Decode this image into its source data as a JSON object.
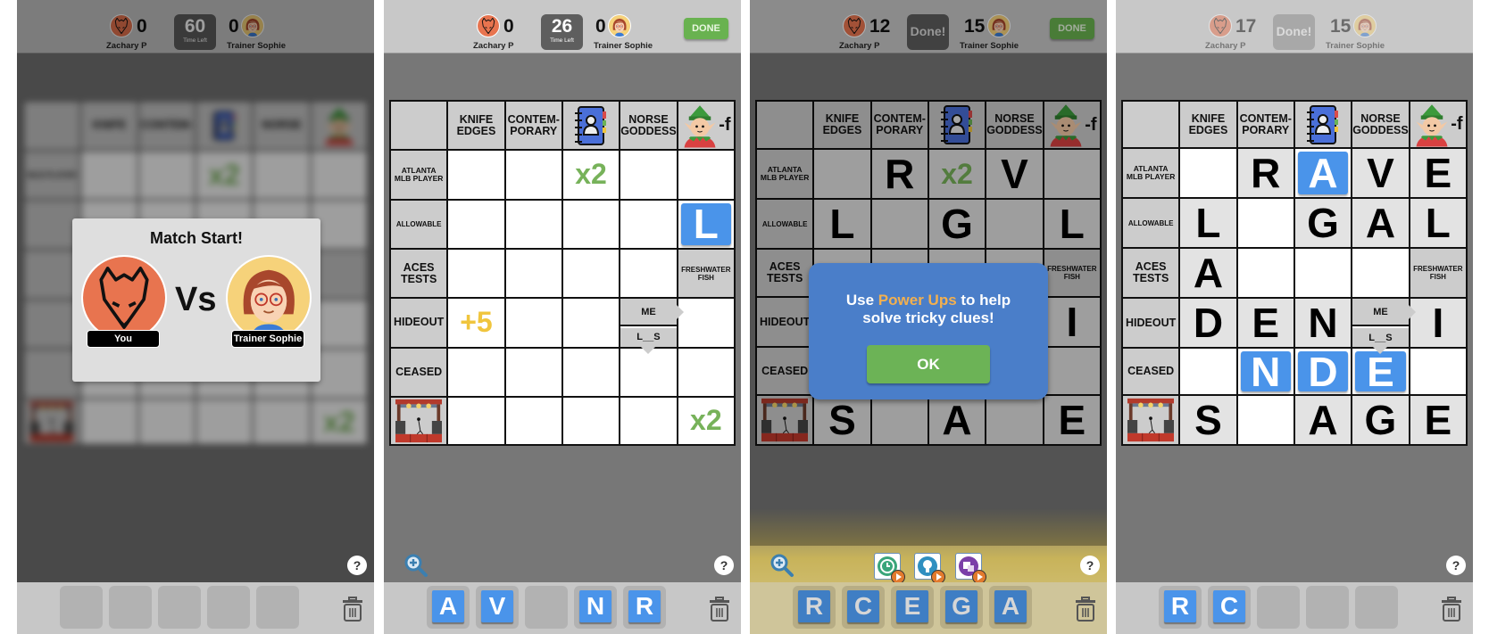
{
  "players": {
    "you": "Zachary P",
    "opponent": "Trainer Sophie"
  },
  "timer_label": "Time Left",
  "done_button": "DONE",
  "done_status": "Done!",
  "help_label": "?",
  "columns": [
    "KNIFE EDGES",
    "CONTEM- PORARY",
    "contacts-book-icon",
    "NORSE GODDESS",
    "elf-minus-f-icon"
  ],
  "col_labels": {
    "c1": "KNIFE",
    "c1b": "EDGES",
    "c2": "CONTEM-",
    "c2b": "PORARY",
    "c4": "NORSE",
    "c4b": "GODDESS",
    "c5suffix": "-f"
  },
  "rows": {
    "r1a": "ATLANTA",
    "r1b": "MLB PLAYER",
    "r2": "ALLOWABLE",
    "r3a": "ACES",
    "r3b": "TESTS",
    "r4": "HIDEOUT",
    "r5": "CEASED",
    "r6": "stage-icon"
  },
  "inline_clues": {
    "freshwater_a": "FRESHWATER",
    "freshwater_b": "FISH",
    "me": "ME",
    "l_s": "L__S"
  },
  "bonuses": {
    "x2": "x2",
    "plus5": "+5"
  },
  "panel1": {
    "score_you": "0",
    "score_opp": "0",
    "timer": "60",
    "modal_title": "Match Start!",
    "vs": "Vs",
    "you_tag": "You",
    "opp_tag": "Trainer Sophie",
    "tray": [
      "",
      "",
      "",
      "",
      ""
    ]
  },
  "panel2": {
    "score_you": "0",
    "score_opp": "0",
    "timer": "26",
    "placed_tile": "L",
    "tray": [
      "A",
      "V",
      "",
      "N",
      "R"
    ]
  },
  "panel3": {
    "score_you": "12",
    "score_opp": "15",
    "letters": {
      "r1c2": "R",
      "r1c4": "V",
      "r2c1": "L",
      "r2c3": "G",
      "r2c5": "L",
      "r4c5": "I",
      "r6c1": "S",
      "r6c3": "A",
      "r6c5": "E"
    },
    "modal_msg_a": "Use ",
    "modal_msg_hl": "Power Ups",
    "modal_msg_b": " to help",
    "modal_msg_c": "solve tricky clues!",
    "ok_button": "OK",
    "powerups": [
      "clock-powerup-icon",
      "lightbulb-powerup-icon",
      "swap-powerup-icon"
    ],
    "tray": [
      "R",
      "C",
      "E",
      "G",
      "A"
    ]
  },
  "panel4": {
    "score_you": "17",
    "score_opp": "15",
    "letters": {
      "r1c2": "R",
      "r1c4": "V",
      "r1c5": "E",
      "r2c1": "L",
      "r2c3": "G",
      "r2c4": "A",
      "r2c5": "L",
      "r3c1": "A",
      "r4c1": "D",
      "r4c2": "E",
      "r4c3": "N",
      "r4c5": "I",
      "r6c1": "S",
      "r6c3": "A",
      "r6c4": "G",
      "r6c5": "E"
    },
    "tiles": {
      "r1c3": "A",
      "r5c2": "N",
      "r5c3": "D",
      "r5c4": "E"
    },
    "tray": [
      "R",
      "C",
      "",
      "",
      ""
    ]
  },
  "colors": {
    "tile_blue": "#4a94ea",
    "bonus_green": "#77b25a",
    "bonus_yellow": "#f0c53d",
    "done_green": "#69b250",
    "modal_blue": "#4a7ec9",
    "highlight_orange": "#f3b04f",
    "fox_orange": "#e8744f"
  }
}
